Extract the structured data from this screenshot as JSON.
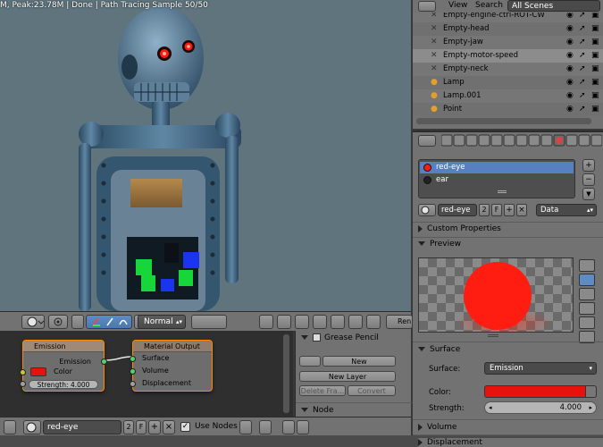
{
  "viewport": {
    "status": "M, Peak:23.78M | Done | Path Tracing Sample 50/50"
  },
  "view_header": {
    "shading_mode": "Normal",
    "render_label": "Ren"
  },
  "node_editor": {
    "emission_node": {
      "title": "Emission",
      "output": "Emission",
      "color_label": "Color",
      "strength_label": "Strength:",
      "strength_value": "4.000",
      "color": "#e8120c"
    },
    "output_node": {
      "title": "Material Output",
      "inputs": [
        "Surface",
        "Volume",
        "Displacement"
      ]
    }
  },
  "grease_pencil": {
    "title": "Grease Pencil",
    "new_button": "New",
    "new_layer_button": "New Layer",
    "delete_frame_button": "Delete Fra...",
    "convert_button": "Convert",
    "node_section": "Node"
  },
  "bottom_bar": {
    "material_name": "red-eye",
    "user_count": "2",
    "fake_user": "F",
    "use_nodes_label": "Use Nodes"
  },
  "outliner": {
    "view_menu": "View",
    "search_menu": "Search",
    "scene_select": "All Scenes",
    "items": [
      {
        "name": "Empty-engine-ctrl-ROT-CW"
      },
      {
        "name": "Empty-head"
      },
      {
        "name": "Empty-jaw"
      },
      {
        "name": "Empty-motor-speed"
      },
      {
        "name": "Empty-neck"
      },
      {
        "name": "Lamp"
      },
      {
        "name": "Lamp.001"
      },
      {
        "name": "Point"
      }
    ]
  },
  "properties": {
    "material_slots": [
      {
        "name": "red-eye",
        "color": "#ff1a10"
      },
      {
        "name": "ear",
        "color": "#222222"
      }
    ],
    "material_name": "red-eye",
    "user_count": "2",
    "fake_user": "F",
    "link_select": "Data",
    "custom_properties": "Custom Properties",
    "preview": "Preview",
    "surface_section": "Surface",
    "surface_label": "Surface:",
    "surface_value": "Emission",
    "color_label": "Color:",
    "color_value": "#e8120c",
    "strength_label": "Strength:",
    "strength_value": "4.000",
    "volume_section": "Volume",
    "displacement_section": "Displacement"
  }
}
